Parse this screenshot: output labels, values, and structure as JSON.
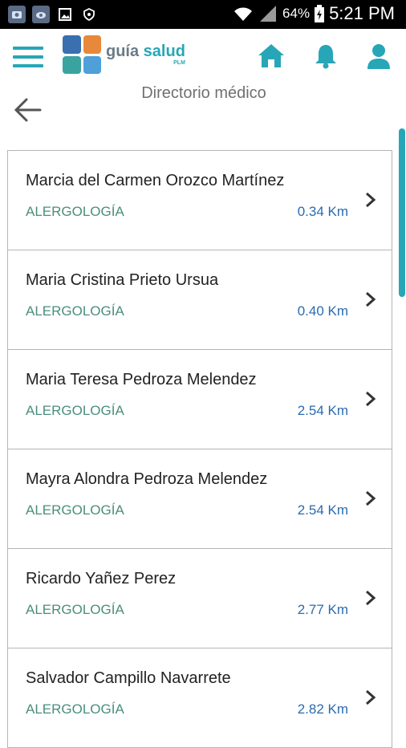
{
  "statusbar": {
    "battery": "64%",
    "time": "5:21 PM",
    "icons": [
      "photo-app-icon",
      "chrome-cloud-icon",
      "image-icon",
      "shield-icon",
      "wifi-icon",
      "signal-icon",
      "battery-icon"
    ]
  },
  "header": {
    "logo_text_1": "guía ",
    "logo_text_2": "salud",
    "logo_sub": "PLM",
    "icons": [
      "menu-icon",
      "home-icon",
      "bell-icon",
      "user-icon"
    ],
    "accent": "#27a6b7"
  },
  "page": {
    "title": "Directorio médico"
  },
  "doctors": [
    {
      "name": "Marcia del Carmen Orozco Martínez",
      "specialty": "ALERGOLOGÍA",
      "distance": "0.34 Km"
    },
    {
      "name": "Maria Cristina Prieto Ursua",
      "specialty": "ALERGOLOGÍA",
      "distance": "0.40 Km"
    },
    {
      "name": "Maria Teresa Pedroza Melendez",
      "specialty": "ALERGOLOGÍA",
      "distance": "2.54 Km"
    },
    {
      "name": "Mayra Alondra Pedroza Melendez",
      "specialty": "ALERGOLOGÍA",
      "distance": "2.54 Km"
    },
    {
      "name": "Ricardo Yañez Perez",
      "specialty": "ALERGOLOGÍA",
      "distance": "2.77 Km"
    },
    {
      "name": "Salvador Campillo Navarrete",
      "specialty": "ALERGOLOGÍA",
      "distance": "2.82 Km"
    }
  ]
}
